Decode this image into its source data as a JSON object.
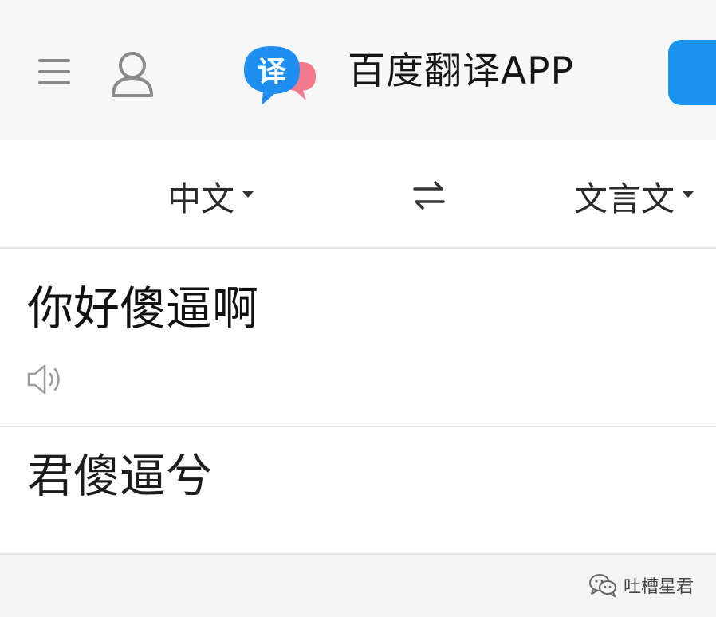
{
  "header": {
    "app_name": "百度翻译APP",
    "logo_glyph": "译",
    "logo_colors": {
      "bubble": "#1e8ff0",
      "accent_bubble": "#f27a8a"
    },
    "cta_color": "#1a93ef",
    "icons": {
      "menu": "menu-icon",
      "user": "user-icon"
    }
  },
  "language_bar": {
    "source_language": "中文",
    "target_language": "文言文",
    "swap_icon": "swap-arrows-icon"
  },
  "input": {
    "source_text": "你好傻逼啊",
    "speaker_icon": "speaker-icon"
  },
  "output": {
    "result_text": "君傻逼兮"
  },
  "footer": {
    "watermark": "吐槽星君",
    "wechat_icon": "wechat-icon"
  }
}
